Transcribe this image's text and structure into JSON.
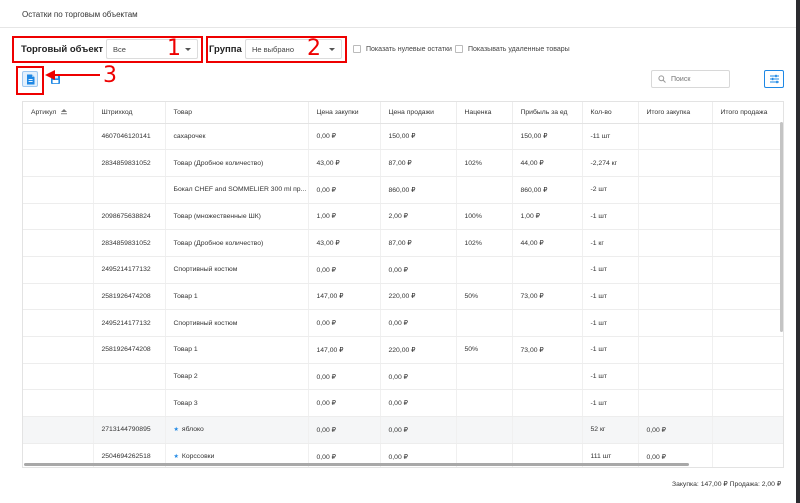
{
  "page": {
    "title": "Остатки по торговым объектам"
  },
  "filters": {
    "store_label": "Торговый объект",
    "store_value": "Все",
    "group_label": "Группа",
    "group_value": "Не выбрано",
    "show_zero_label": "Показать нулевые остатки",
    "show_deleted_label": "Показывать удаленные товары"
  },
  "annotations": {
    "one": "1",
    "two": "2",
    "three": "3"
  },
  "search": {
    "placeholder": "Поиск"
  },
  "table": {
    "columns": [
      "Артикул",
      "Штрихкод",
      "Товар",
      "Цена закупки",
      "Цена продажи",
      "Наценка",
      "Прибыль за ед",
      "Кол-во",
      "Итого закупка",
      "Итого продажа"
    ],
    "rows": [
      {
        "article": "",
        "barcode": "4607046120141",
        "product": "сахарочек",
        "starred": false,
        "buy": "0,00 ₽",
        "sell": "150,00 ₽",
        "markup": "",
        "profit": "150,00 ₽",
        "qty": "-11 шт",
        "total_buy": "",
        "total_sell": ""
      },
      {
        "article": "",
        "barcode": "2834859831052",
        "product": "Товар (Дробное количество)",
        "starred": false,
        "buy": "43,00 ₽",
        "sell": "87,00 ₽",
        "markup": "102%",
        "profit": "44,00 ₽",
        "qty": "-2,274 кг",
        "total_buy": "",
        "total_sell": ""
      },
      {
        "article": "",
        "barcode": "",
        "product": "Бокал CHEF and SOMMELIER 300 ml пр...",
        "starred": false,
        "buy": "0,00 ₽",
        "sell": "860,00 ₽",
        "markup": "",
        "profit": "860,00 ₽",
        "qty": "-2 шт",
        "total_buy": "",
        "total_sell": ""
      },
      {
        "article": "",
        "barcode": "2098675638824",
        "product": "Товар (множественные ШК)",
        "starred": false,
        "buy": "1,00 ₽",
        "sell": "2,00 ₽",
        "markup": "100%",
        "profit": "1,00 ₽",
        "qty": "-1 шт",
        "total_buy": "",
        "total_sell": ""
      },
      {
        "article": "",
        "barcode": "2834859831052",
        "product": "Товар (Дробное количество)",
        "starred": false,
        "buy": "43,00 ₽",
        "sell": "87,00 ₽",
        "markup": "102%",
        "profit": "44,00 ₽",
        "qty": "-1 кг",
        "total_buy": "",
        "total_sell": ""
      },
      {
        "article": "",
        "barcode": "2495214177132",
        "product": "Спортивный костюм",
        "starred": false,
        "buy": "0,00 ₽",
        "sell": "0,00 ₽",
        "markup": "",
        "profit": "",
        "qty": "-1 шт",
        "total_buy": "",
        "total_sell": ""
      },
      {
        "article": "",
        "barcode": "2581926474208",
        "product": "Товар 1",
        "starred": false,
        "buy": "147,00 ₽",
        "sell": "220,00 ₽",
        "markup": "50%",
        "profit": "73,00 ₽",
        "qty": "-1 шт",
        "total_buy": "",
        "total_sell": ""
      },
      {
        "article": "",
        "barcode": "2495214177132",
        "product": "Спортивный костюм",
        "starred": false,
        "buy": "0,00 ₽",
        "sell": "0,00 ₽",
        "markup": "",
        "profit": "",
        "qty": "-1 шт",
        "total_buy": "",
        "total_sell": ""
      },
      {
        "article": "",
        "barcode": "2581926474208",
        "product": "Товар 1",
        "starred": false,
        "buy": "147,00 ₽",
        "sell": "220,00 ₽",
        "markup": "50%",
        "profit": "73,00 ₽",
        "qty": "-1 шт",
        "total_buy": "",
        "total_sell": ""
      },
      {
        "article": "",
        "barcode": "",
        "product": "Товар 2",
        "starred": false,
        "buy": "0,00 ₽",
        "sell": "0,00 ₽",
        "markup": "",
        "profit": "",
        "qty": "-1 шт",
        "total_buy": "",
        "total_sell": ""
      },
      {
        "article": "",
        "barcode": "",
        "product": "Товар 3",
        "starred": false,
        "buy": "0,00 ₽",
        "sell": "0,00 ₽",
        "markup": "",
        "profit": "",
        "qty": "-1 шт",
        "total_buy": "",
        "total_sell": ""
      },
      {
        "article": "",
        "barcode": "2713144790895",
        "product": "яблоко",
        "starred": true,
        "buy": "0,00 ₽",
        "sell": "0,00 ₽",
        "markup": "",
        "profit": "",
        "qty": "52 кг",
        "total_buy": "0,00 ₽",
        "total_sell": "",
        "highlight": true
      },
      {
        "article": "",
        "barcode": "2504694262518",
        "product": "Корссовки",
        "starred": true,
        "buy": "0,00 ₽",
        "sell": "0,00 ₽",
        "markup": "",
        "profit": "",
        "qty": "111 шт",
        "total_buy": "0,00 ₽",
        "total_sell": ""
      }
    ]
  },
  "footer": {
    "totals": "Закупка: 147,00 ₽  Продажа: 2,00 ₽"
  },
  "colors": {
    "accent": "#1e88e5",
    "annotation": "#e00000"
  },
  "icons": [
    "caret-down-icon",
    "excel-export-icon",
    "save-export-icon",
    "search-icon",
    "column-settings-icon",
    "sort-icon",
    "star-icon"
  ]
}
